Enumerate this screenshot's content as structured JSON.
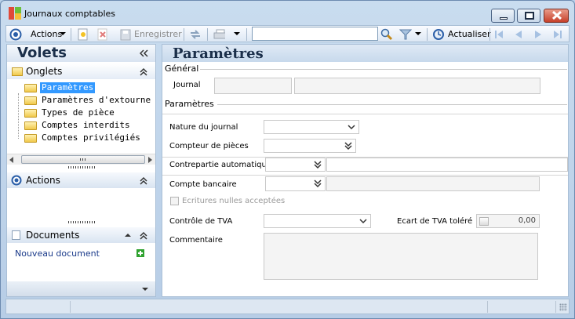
{
  "window": {
    "title": "Journaux comptables"
  },
  "toolbar": {
    "actions_label": "Actions",
    "save_label": "Enregistrer",
    "search_value": "",
    "refresh_label": "Actualiser"
  },
  "left": {
    "title": "Volets",
    "tabs_section": "Onglets",
    "tree_items": [
      "Paramètres",
      "Paramètres d'extourne",
      "Types de pièce",
      "Comptes interdits",
      "Comptes privilégiés"
    ],
    "actions_section": "Actions",
    "documents_section": "Documents",
    "new_document": "Nouveau document"
  },
  "main": {
    "title": "Paramètres",
    "general_group": "Général",
    "journal_label": "Journal",
    "journal_code": "",
    "journal_name": "",
    "params_group": "Paramètres",
    "nature_label": "Nature du journal",
    "nature_value": "",
    "compteur_label": "Compteur de pièces",
    "compteur_value": "",
    "contrepartie_label": "Contrepartie automatique",
    "contrepartie_value": "",
    "compte_bancaire_label": "Compte bancaire",
    "compte_bancaire_value": "",
    "ecritures_label": "Ecritures nulles acceptées",
    "controle_tva_label": "Contrôle de TVA",
    "controle_tva_value": "",
    "ecart_tva_label": "Ecart de TVA toléré",
    "ecart_tva_value": "0,00",
    "commentaire_label": "Commentaire",
    "commentaire_value": ""
  },
  "colors": {
    "selection": "#3399ff",
    "accent": "#1b2f4a",
    "link": "#1a3a8a",
    "add": "#2fa22f"
  },
  "icons": [
    "app-icon",
    "minimize-icon",
    "maximize-icon",
    "close-icon",
    "actions-circle-icon",
    "new-icon",
    "delete-icon",
    "save-icon",
    "sync-icon",
    "print-icon",
    "search-icon",
    "filter-icon",
    "refresh-icon",
    "first-icon",
    "prev-icon",
    "next-icon",
    "last-icon",
    "folder-icon",
    "add-icon",
    "collapse-icon"
  ]
}
